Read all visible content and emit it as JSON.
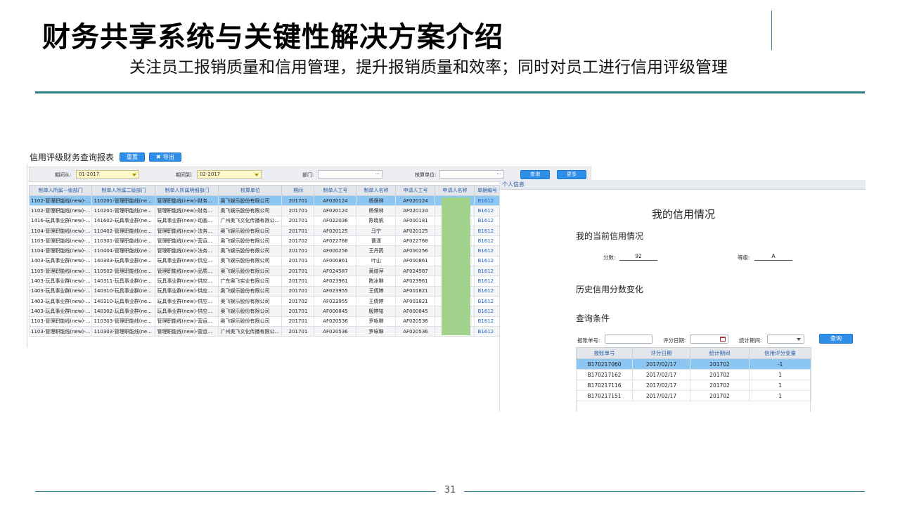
{
  "slide": {
    "title": "财务共享系统与关键性解决方案介绍",
    "subtitle": "关注员工报销质量和信用管理，提升报销质量和效率；同时对员工进行信用评级管理",
    "page_number": "31",
    "accent_color": "#2a7f86"
  },
  "report": {
    "title": "信用评级财务查询报表",
    "reset_label": "重置",
    "export_label": "导出",
    "export_icon": "close-x-icon",
    "filters": {
      "period_from_label": "期间从:",
      "period_from_value": "01-2017",
      "period_to_label": "期间到:",
      "period_to_value": "02-2017",
      "dept_label": "部门:",
      "dept_value": "···",
      "unit_label": "核算单位:",
      "unit_value": "···",
      "query_label": "查询",
      "more_label": "更多"
    },
    "columns": [
      "制单人所属一级部门",
      "制单人所属二级部门",
      "制单人所属明细部门",
      "核算单位",
      "期间",
      "制单人工号",
      "制单人名称",
      "申请人工号",
      "申请人名称",
      "单据编号"
    ],
    "rows": [
      [
        "1102-管理职能线(new)-...",
        "110201-管理职能线(ne...",
        "管理职能线(new)-财务...",
        "奥飞娱乐股份有限公司",
        "201701",
        "AF020124",
        "杨保林",
        "AF020124",
        "",
        "B1612"
      ],
      [
        "1102-管理职能线(new)-...",
        "110201-管理职能线(ne...",
        "管理职能线(new)-财务...",
        "奥飞娱乐股份有限公司",
        "201701",
        "AF020124",
        "杨保林",
        "AF020124",
        "",
        "B1612"
      ],
      [
        "1416-玩具事业群(new)-...",
        "141602-玩具事业群(ne...",
        "玩具事业群(new)-动画...",
        "广州奥飞文化传播有限公...",
        "201701",
        "AF022036",
        "陈晓帆",
        "AF000181",
        "",
        "B1612"
      ],
      [
        "1104-管理职能线(new)-...",
        "110402-管理职能线(ne...",
        "管理职能线(new)-法务...",
        "奥飞娱乐股份有限公司",
        "201701",
        "AF020125",
        "马宁",
        "AF020125",
        "",
        "B1612"
      ],
      [
        "1103-管理职能线(new)-...",
        "110301-管理职能线(ne...",
        "管理职能线(new)-营运...",
        "奥飞娱乐股份有限公司",
        "201702",
        "AF022768",
        "曹潇",
        "AF022768",
        "",
        "B1612"
      ],
      [
        "1104-管理职能线(new)-...",
        "110404-管理职能线(ne...",
        "管理职能线(new)-法务...",
        "奥飞娱乐股份有限公司",
        "201701",
        "AF000256",
        "王丹菂",
        "AF000256",
        "",
        "B1612"
      ],
      [
        "1403-玩具事业群(new)-...",
        "140303-玩具事业群(ne...",
        "玩具事业群(new)-供应...",
        "奥飞娱乐股份有限公司",
        "201701",
        "AF000861",
        "叶山",
        "AF000861",
        "",
        "B1612"
      ],
      [
        "1105-管理职能线(new)-...",
        "110502-管理职能线(ne...",
        "管理职能线(new)-品质...",
        "奥飞娱乐股份有限公司",
        "201701",
        "AF024587",
        "黄煊萍",
        "AF024587",
        "",
        "B1612"
      ],
      [
        "1403-玩具事业群(new)-...",
        "140311-玩具事业群(ne...",
        "玩具事业群(new)-供应...",
        "广东奥飞实业有限公司",
        "201701",
        "AF023961",
        "陈冰琳",
        "AF023961",
        "",
        "B1612"
      ],
      [
        "1403-玩具事业群(new)-...",
        "140310-玩具事业群(ne...",
        "玩具事业群(new)-供应...",
        "奥飞娱乐股份有限公司",
        "201701",
        "AF023955",
        "王倩婷",
        "AF001821",
        "",
        "B1612"
      ],
      [
        "1403-玩具事业群(new)-...",
        "140310-玩具事业群(ne...",
        "玩具事业群(new)-供应...",
        "奥飞娱乐股份有限公司",
        "201702",
        "AF023955",
        "王倩婷",
        "AF001821",
        "",
        "B1612"
      ],
      [
        "1403-玩具事业群(new)-...",
        "140302-玩具事业群(ne...",
        "玩具事业群(new)-供应...",
        "奥飞娱乐股份有限公司",
        "201701",
        "AF000845",
        "殷婷铭",
        "AF000845",
        "",
        "B1612"
      ],
      [
        "1103-管理职能线(new)-...",
        "110303-管理职能线(ne...",
        "管理职能线(new)-营运...",
        "奥飞娱乐股份有限公司",
        "201701",
        "AF020536",
        "罗咏琳",
        "AF020536",
        "",
        "B1612"
      ],
      [
        "1103-管理职能线(new)-...",
        "110303-管理职能线(ne...",
        "管理职能线(new)-营运...",
        "广州奥飞文化传播有限公...",
        "201701",
        "AF020536",
        "罗咏琳",
        "AF020536",
        "",
        "B1612"
      ]
    ]
  },
  "credit": {
    "tab_label": "个人信息",
    "title": "我的信用情况",
    "current_section": "我的当前信用情况",
    "score_label": "分数:",
    "score_value": "92",
    "grade_label": "等级:",
    "grade_value": "A",
    "history_section": "历史信用分数变化",
    "query_section": "查询条件",
    "doc_no_label": "报账单号:",
    "score_date_label": "评分日期:",
    "stat_period_label": "统计期间:",
    "query_button": "查询",
    "columns": [
      "报账单号",
      "评分日期",
      "统计期间",
      "信用评分变量"
    ],
    "rows": [
      [
        "B170217060",
        "2017/02/17",
        "201702",
        "-1"
      ],
      [
        "B170217162",
        "2017/02/17",
        "201702",
        "1"
      ],
      [
        "B170217116",
        "2017/02/17",
        "201702",
        "1"
      ],
      [
        "B170217151",
        "2017/02/17",
        "201702",
        "1"
      ]
    ]
  }
}
